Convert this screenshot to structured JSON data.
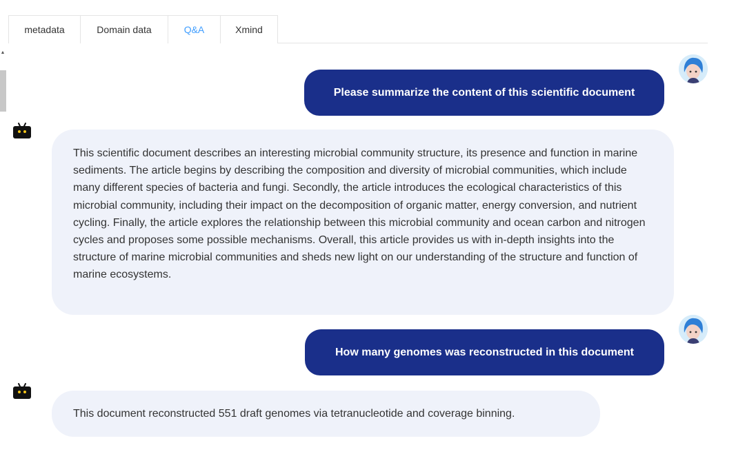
{
  "tabs": [
    {
      "label": "metadata",
      "active": false
    },
    {
      "label": "Domain data",
      "active": false
    },
    {
      "label": "Q&A",
      "active": true
    },
    {
      "label": "Xmind",
      "active": false
    }
  ],
  "colors": {
    "accent": "#409eff",
    "user_bubble": "#1a2f8a",
    "bot_bubble": "#eff2fa"
  },
  "messages": [
    {
      "role": "user",
      "text": "Please summarize the content of this scientific document"
    },
    {
      "role": "bot",
      "text": "This scientific document describes an interesting microbial community structure, its presence and function in marine sediments. The article begins by describing the composition and diversity of microbial communities, which include many different species of bacteria and fungi. Secondly, the article introduces the ecological characteristics of this microbial community, including their impact on the decomposition of organic matter, energy conversion, and nutrient cycling. Finally, the article explores the relationship between this microbial community and ocean carbon and nitrogen cycles and proposes some possible mechanisms. Overall, this article provides us with in-depth insights into the structure of marine microbial communities and sheds new light on our understanding of the structure and function of marine ecosystems."
    },
    {
      "role": "user",
      "text": "How many genomes was reconstructed in this document"
    },
    {
      "role": "bot",
      "text": "This document reconstructed 551 draft genomes via tetranucleotide and coverage binning."
    }
  ]
}
